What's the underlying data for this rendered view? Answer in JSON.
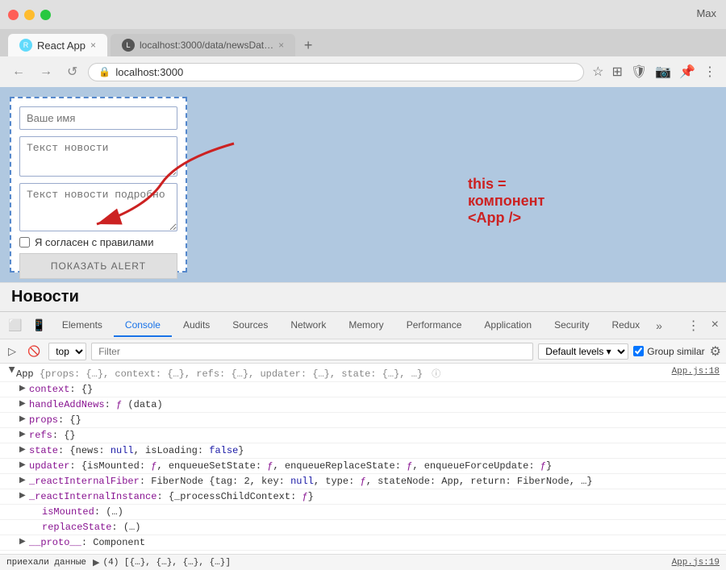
{
  "browser": {
    "title_bar": {
      "user": "Max"
    },
    "tab1": {
      "favicon_label": "R",
      "title": "React App",
      "close": "×"
    },
    "tab2": {
      "title": "localhost:3000/data/newsDat…",
      "close": "×"
    },
    "address": {
      "url": "localhost:3000",
      "lock_icon": "🔒"
    },
    "nav": {
      "back": "←",
      "forward": "→",
      "reload": "↺"
    }
  },
  "page": {
    "form": {
      "name_placeholder": "Ваше имя",
      "news_placeholder": "Текст новости",
      "news_detail_placeholder": "Текст новости подробно",
      "checkbox_label": "Я согласен с правилами",
      "button_label": "ПОКАЗАТЬ ALERT"
    },
    "annotation": "this = компонент <App />",
    "news_title": "Новости"
  },
  "devtools": {
    "tabs": [
      "Elements",
      "Console",
      "Audits",
      "Sources",
      "Network",
      "Memory",
      "Performance",
      "Application",
      "Security",
      "Redux"
    ],
    "active_tab": "Console",
    "more_icon": "»",
    "close_icon": "×",
    "settings_icon": "⚙",
    "toolbar": {
      "clear_btn": "🚫",
      "filter_placeholder": "Filter",
      "context_select": "top",
      "levels_label": "Default levels",
      "group_similar": "Group similar"
    },
    "console_lines": [
      {
        "id": "app-root",
        "indent": 0,
        "expanded": true,
        "content": "▼ App {props: {…}, context: {…}, refs: {…}, updater: {…}, state: {…}, …}",
        "info_icon": "ⓘ",
        "link": "App.js:18"
      },
      {
        "id": "context",
        "indent": 1,
        "expanded": false,
        "content": "▶ context: {}"
      },
      {
        "id": "handleAddNews",
        "indent": 1,
        "expanded": false,
        "content": "▶ handleAddNews: ƒ (data)"
      },
      {
        "id": "props",
        "indent": 1,
        "expanded": false,
        "content": "▶ props: {}"
      },
      {
        "id": "refs",
        "indent": 1,
        "expanded": false,
        "content": "▶ refs: {}"
      },
      {
        "id": "state",
        "indent": 1,
        "expanded": false,
        "content": "▶ state: {news: null, isLoading: false}"
      },
      {
        "id": "updater",
        "indent": 1,
        "expanded": false,
        "content": "▶ updater: {isMounted: ƒ, enqueueSetState: ƒ, enqueueReplaceState: ƒ, enqueueForceUpdate: ƒ}"
      },
      {
        "id": "reactFiber",
        "indent": 1,
        "expanded": false,
        "content": "▶ _reactInternalFiber: FiberNode {tag: 2, key: null, type: ƒ, stateNode: App, return: FiberNode, …}"
      },
      {
        "id": "reactInstance",
        "indent": 1,
        "expanded": false,
        "content": "▶ _reactInternalInstance: {_processChildContext: ƒ}"
      },
      {
        "id": "isMounted",
        "indent": 2,
        "expanded": false,
        "content": "isMounted: (…)"
      },
      {
        "id": "replaceState",
        "indent": 2,
        "expanded": false,
        "content": "replaceState: (…)"
      },
      {
        "id": "proto",
        "indent": 1,
        "expanded": false,
        "content": "▶ __proto__: Component"
      }
    ],
    "status_line": {
      "left": "приехали данные",
      "middle": "▶ (4) [{…}, {…}, {…}, {…}]",
      "link": "App.js:19"
    }
  }
}
